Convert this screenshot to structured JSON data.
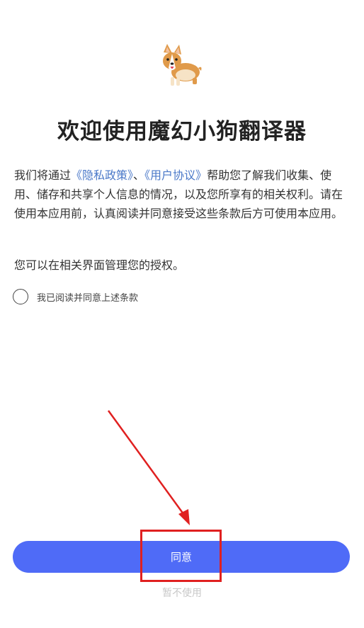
{
  "app": {
    "logo_icon": "corgi-dog-icon",
    "title": "欢迎使用魔幻小狗翻译器"
  },
  "intro": {
    "prefix": "我们将通过",
    "privacy_link": "《隐私政策》",
    "separator": "、",
    "terms_link": "《用户协议》",
    "suffix": "帮助您了解我们收集、使用、储存和共享个人信息的情况，以及您所享有的相关权利。请在使用本应用前，认真阅读并同意接受这些条款后方可使用本应用。"
  },
  "note": "您可以在相关界面管理您的授权。",
  "consent": {
    "label": "我已阅读并同意上述条款",
    "checked": false
  },
  "actions": {
    "agree_label": "同意",
    "decline_label": "暂不使用"
  },
  "colors": {
    "accent": "#4f6bf7",
    "link": "#4a78c8",
    "annotation": "#e02020"
  }
}
